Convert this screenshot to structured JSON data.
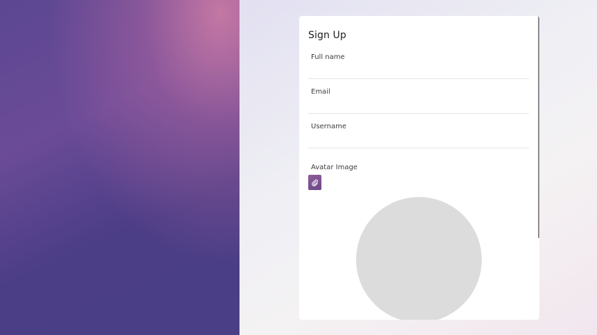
{
  "form": {
    "title": "Sign Up",
    "fields": [
      {
        "label": "Full name",
        "value": ""
      },
      {
        "label": "Email",
        "value": ""
      },
      {
        "label": "Username",
        "value": ""
      }
    ],
    "avatar_label": "Avatar Image"
  },
  "icons": {
    "attach": "paperclip-icon"
  },
  "colors": {
    "accent": "#7a5192",
    "left_gradient_top": "#c97aa4",
    "left_gradient_base": "#4b3d86",
    "avatar_placeholder": "#dcdcdc"
  }
}
